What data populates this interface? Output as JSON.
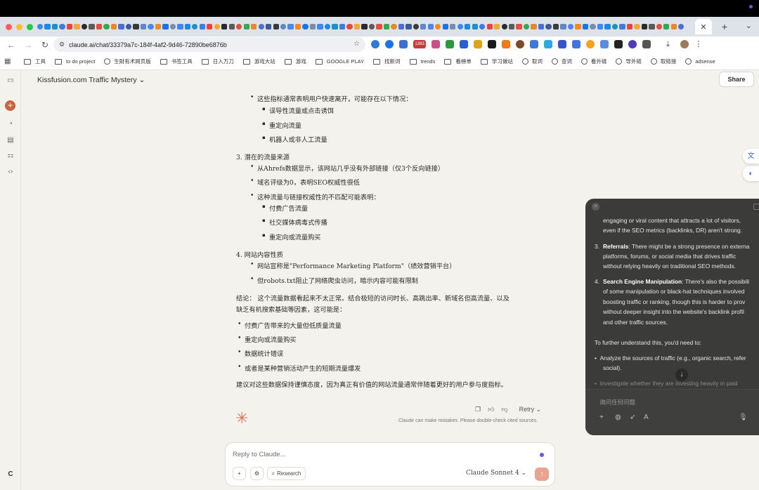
{
  "browser": {
    "url": "claude.ai/chat/33379a7c-184f-4af2-9d46-72890be6876b",
    "bookmarks": [
      {
        "label": "工具",
        "icon": "folder-icon"
      },
      {
        "label": "to do project",
        "icon": "folder-icon"
      },
      {
        "label": "生財有术网页版",
        "icon": "globe-icon"
      },
      {
        "label": "书签工具",
        "icon": "folder-icon"
      },
      {
        "label": "日入万刀",
        "icon": "folder-icon"
      },
      {
        "label": "游戏大站",
        "icon": "folder-icon"
      },
      {
        "label": "游戏",
        "icon": "folder-icon"
      },
      {
        "label": "GOOGLE PLAY",
        "icon": "folder-icon"
      },
      {
        "label": "找新词",
        "icon": "folder-icon"
      },
      {
        "label": "trends",
        "icon": "folder-icon"
      },
      {
        "label": "看榜单",
        "icon": "folder-icon"
      },
      {
        "label": "学习做站",
        "icon": "folder-icon"
      },
      {
        "label": "取词",
        "icon": "globe-icon"
      },
      {
        "label": "查词",
        "icon": "globe-icon"
      },
      {
        "label": "看外链",
        "icon": "globe-icon"
      },
      {
        "label": "导外链",
        "icon": "globe-icon"
      },
      {
        "label": "取链接",
        "icon": "globe-icon"
      },
      {
        "label": "adsense",
        "icon": "globe-icon"
      }
    ],
    "ext_badge": "1383",
    "ext_badge2": "24"
  },
  "header": {
    "title": "Kissfusion.com Traffic Mystery",
    "share_label": "Share"
  },
  "message": {
    "intro_bullet": "这些指标通常表明用户快速离开，可能存在以下情况：",
    "sub1": [
      "误导性流量或点击诱饵",
      "重定向流量",
      "机器人或非人工流量"
    ],
    "section3_title": "3. 潜在的流量来源",
    "section3_items": [
      "从Ahrefs数据显示，该网站几乎没有外部链接（仅3个反向链接）",
      "域名评级为0，表明SEO权威性很低",
      "这种流量与链接权威性的不匹配可能表明："
    ],
    "sub3": [
      "付费广告流量",
      "社交媒体病毒式传播",
      "重定向或流量购买"
    ],
    "section4_title": "4. 网站内容性质",
    "section4_items": [
      "网站宣称是\"Performance Marketing Platform\"（绩效营销平台）",
      "但robots.txt阻止了网络爬虫访问，暗示内容可能有限制"
    ],
    "conclusion_line1": "结论： 这个流量数据看起来不太正常。结合极短的访问时长、高跳出率、新域名但高流量、以及",
    "conclusion_line2": "缺乏有机搜索基础等因素，这可能是：",
    "conclusion_items": [
      "付费广告带来的大量但低质量流量",
      "重定向或流量购买",
      "数据统计错误",
      "或者是某种营销活动产生的短期流量爆发"
    ],
    "final": "建议对这些数据保持谨慎态度，因为真正有价值的网站流量通常伴随着更好的用户参与度指标。",
    "retry_label": "Retry",
    "disclaimer": "Claude can make mistakes. Please double-check cited sources."
  },
  "reply": {
    "placeholder": "Reply to Claude...",
    "research_label": "Research",
    "model_label": "Claude Sonnet 4"
  },
  "panel": {
    "line1": "engaging or viral content that attracts a lot of visitors,",
    "line2": "even if the SEO metrics (backlinks, DR) aren't strong.",
    "item3_num": "3.",
    "item3_bold": "Referrals",
    "item3_l1": ": There might be a strong presence on externa",
    "item3_l2": "platforms, forums, or social media that drives traffic",
    "item3_l3": "without relying heavily on traditional SEO methods.",
    "item4_num": "4.",
    "item4_bold": "Search Engine Manipulation",
    "item4_l1": ": There's also the possibili",
    "item4_l2": "of some manipulation or black-hat techniques involved",
    "item4_l3": "boosting traffic or ranking, though this is harder to prov",
    "item4_l4": "without deeper insight into the website's backlink profil",
    "item4_l5": "and other traffic sources.",
    "further": "To further understand this, you'd need to:",
    "bullet1_l1": "Analyze the sources of traffic (e.g., organic search, refer",
    "bullet1_l2": "social).",
    "bullet2_l1": "Investigate whether they are investing heavily in paid",
    "ask_placeholder": "询问任何问题"
  },
  "sidebar_letter": "C"
}
